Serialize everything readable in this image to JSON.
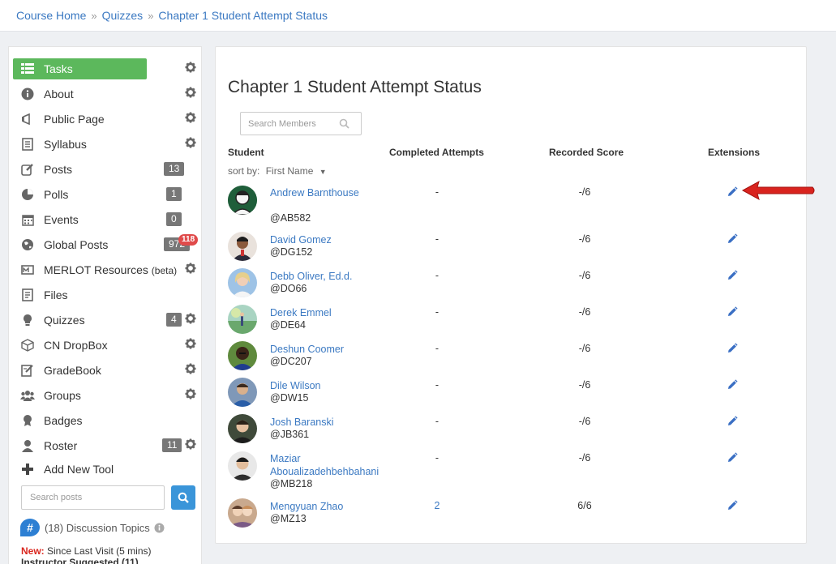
{
  "breadcrumb": [
    "Course Home",
    "Quizzes",
    "Chapter 1 Student Attempt Status"
  ],
  "sidebar": {
    "items": [
      {
        "label": "Tasks",
        "icon": "tasks-icon"
      },
      {
        "label": "About",
        "icon": "info-icon"
      },
      {
        "label": "Public Page",
        "icon": "megaphone-icon"
      },
      {
        "label": "Syllabus",
        "icon": "document-icon"
      },
      {
        "label": "Posts",
        "icon": "edit-icon",
        "count": "13"
      },
      {
        "label": "Polls",
        "icon": "pie-chart-icon",
        "count": "1"
      },
      {
        "label": "Events",
        "icon": "calendar-icon",
        "count": "0"
      },
      {
        "label": "Global Posts",
        "icon": "globe-icon",
        "count": "972",
        "alert": "118"
      },
      {
        "label": "MERLOT Resources",
        "label_suffix": "(beta)",
        "icon": "merlot-icon"
      },
      {
        "label": "Files",
        "icon": "files-icon"
      },
      {
        "label": "Quizzes",
        "icon": "lightbulb-icon",
        "count": "4"
      },
      {
        "label": "CN DropBox",
        "icon": "cube-icon"
      },
      {
        "label": "GradeBook",
        "icon": "gradebook-icon"
      },
      {
        "label": "Groups",
        "icon": "groups-icon"
      },
      {
        "label": "Badges",
        "icon": "badge-icon"
      },
      {
        "label": "Roster",
        "icon": "user-icon",
        "count": "11"
      },
      {
        "label": "Add New Tool",
        "icon": "plus-icon"
      }
    ],
    "search_placeholder": "Search posts",
    "discussion": "(18) Discussion Topics",
    "new_label": "New:",
    "new_text": "Since Last Visit (5 mins)",
    "suggested": "Instructor Suggested (11)"
  },
  "main": {
    "title": "Chapter 1 Student Attempt Status",
    "search_placeholder": "Search Members",
    "columns": {
      "student": "Student",
      "attempts": "Completed Attempts",
      "score": "Recorded Score",
      "extensions": "Extensions"
    },
    "sort_label": "sort by:",
    "sort_value": "First Name",
    "students": [
      {
        "name": "Andrew Barnthouse",
        "handle": "@AB582",
        "attempts": "-",
        "score": "-/6"
      },
      {
        "name": "David Gomez",
        "handle": "@DG152",
        "attempts": "-",
        "score": "-/6"
      },
      {
        "name": "Debb Oliver, Ed.d.",
        "handle": "@DO66",
        "attempts": "-",
        "score": "-/6"
      },
      {
        "name": "Derek Emmel",
        "handle": "@DE64",
        "attempts": "-",
        "score": "-/6"
      },
      {
        "name": "Deshun Coomer",
        "handle": "@DC207",
        "attempts": "-",
        "score": "-/6"
      },
      {
        "name": "Dile Wilson",
        "handle": "@DW15",
        "attempts": "-",
        "score": "-/6"
      },
      {
        "name": "Josh Baranski",
        "handle": "@JB361",
        "attempts": "-",
        "score": "-/6"
      },
      {
        "name": "Maziar Aboualizadehbehbahani",
        "handle": "@MB218",
        "attempts": "-",
        "score": "-/6"
      },
      {
        "name": "Mengyuan Zhao",
        "handle": "@MZ13",
        "attempts": "2",
        "score": "6/6"
      }
    ]
  },
  "colors": {
    "accent": "#5cb85c",
    "link": "#3b79c2",
    "alert": "#e04b4b",
    "arrow": "#d9231e"
  }
}
